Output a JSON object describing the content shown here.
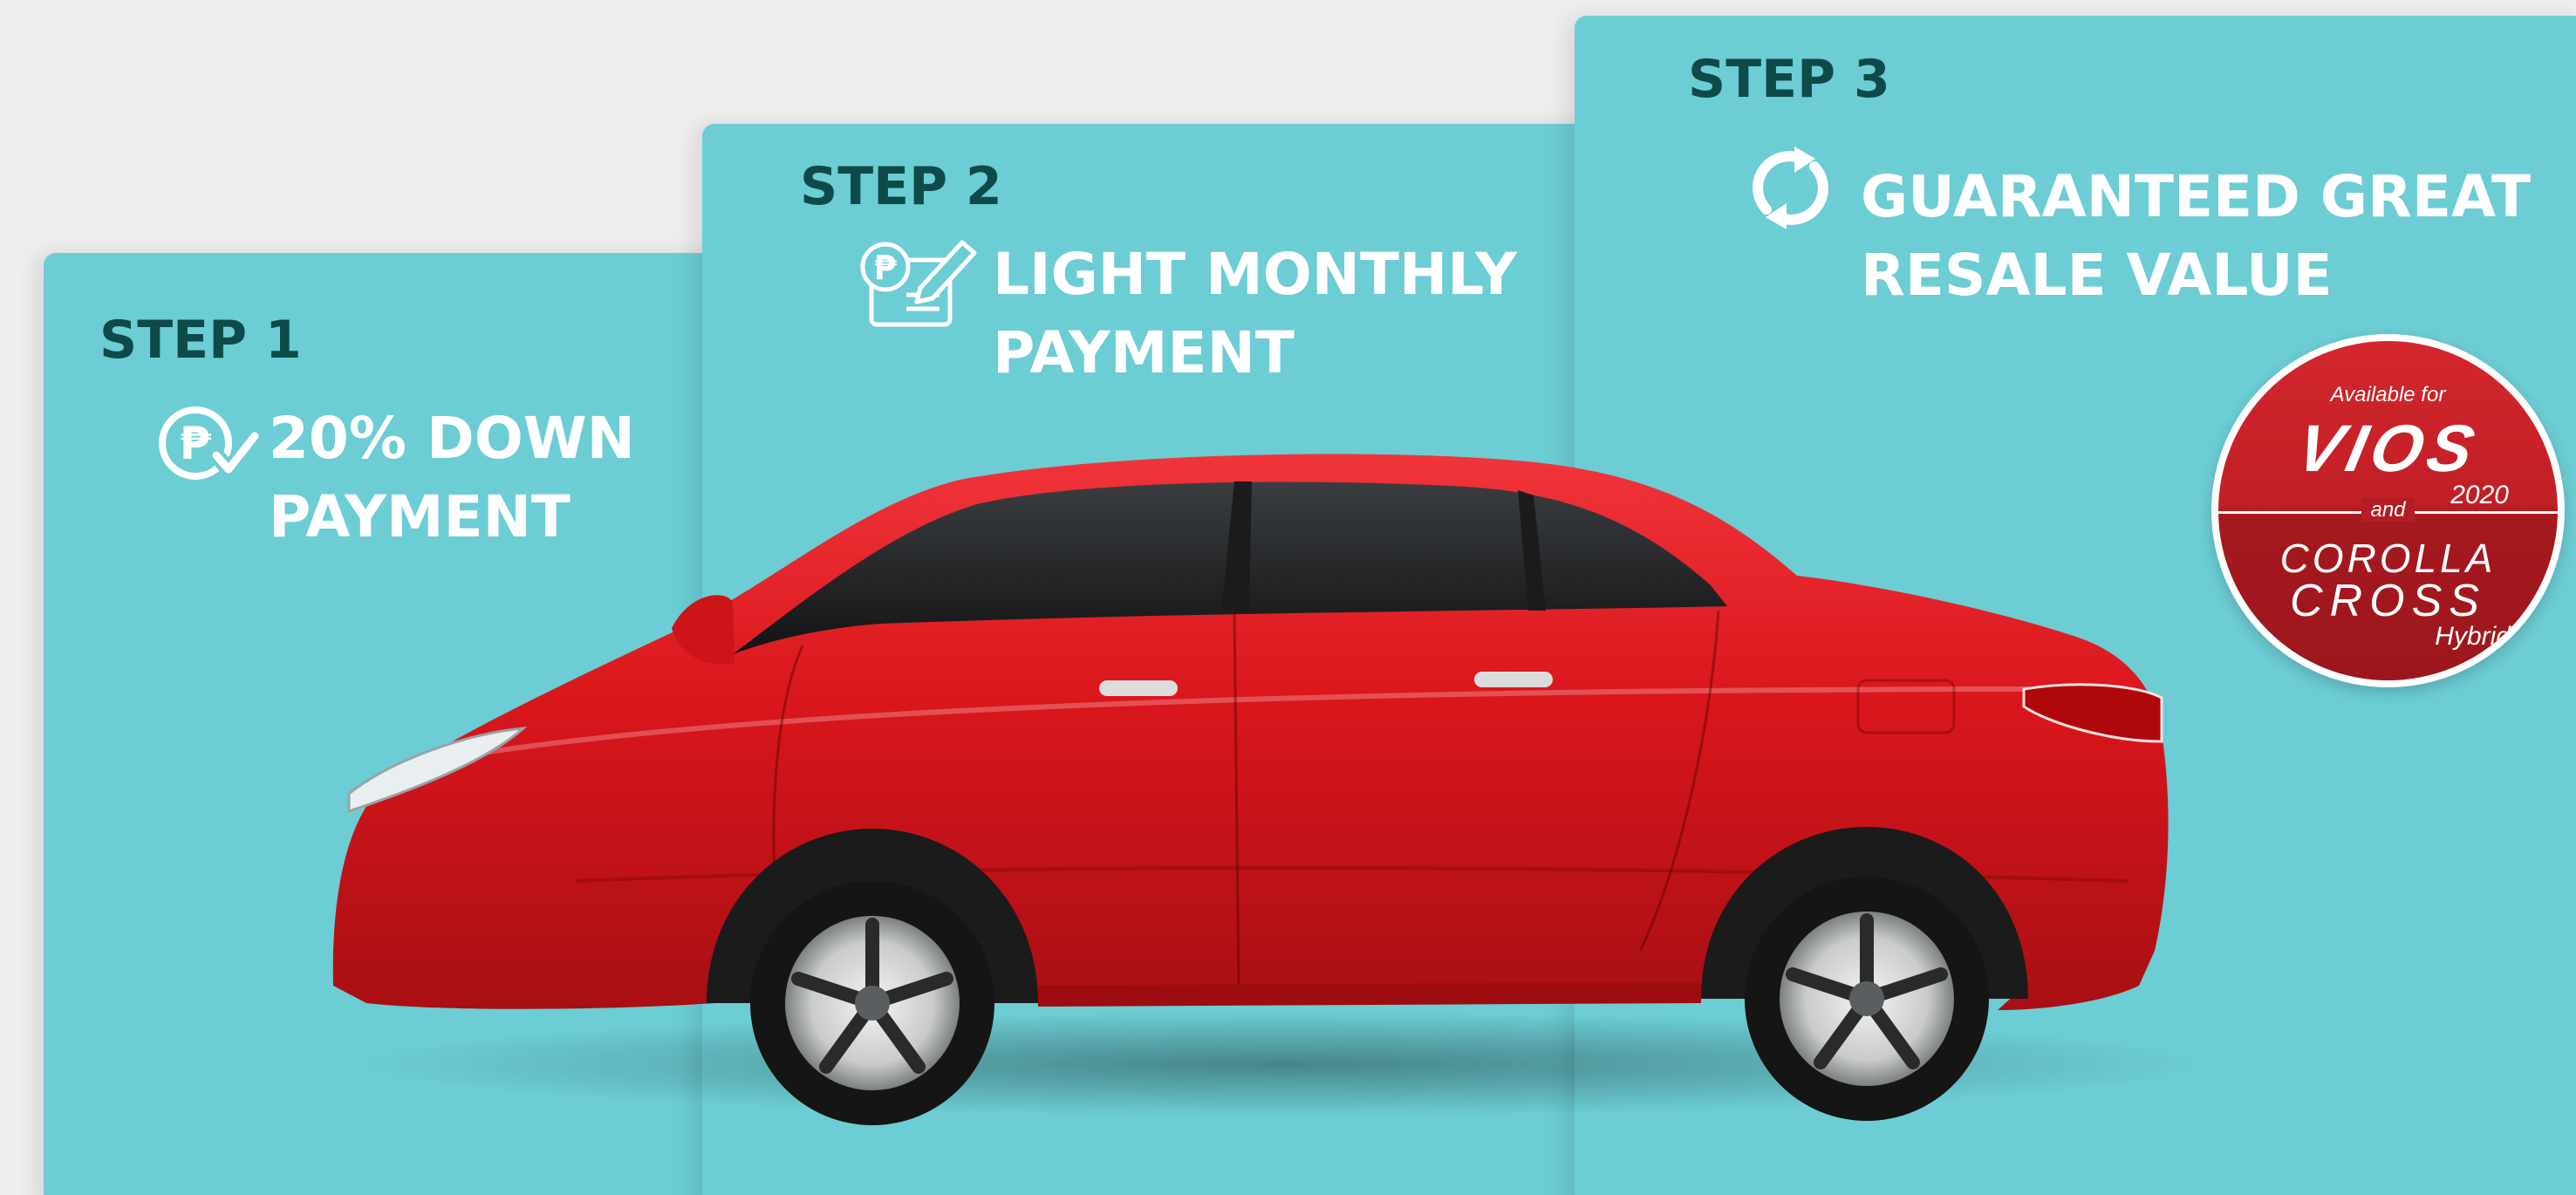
{
  "steps": [
    {
      "label": "STEP 1",
      "headline_line1": "20% DOWN",
      "headline_line2": "PAYMENT",
      "icon": "peso-check-icon"
    },
    {
      "label": "STEP 2",
      "headline_line1": "LIGHT MONTHLY",
      "headline_line2": "PAYMENT",
      "icon": "peso-document-sign-icon"
    },
    {
      "label": "STEP 3",
      "headline_line1": "GUARANTEED GREAT",
      "headline_line2": "RESALE VALUE",
      "icon": "refresh-cycle-icon"
    }
  ],
  "badge": {
    "available": "Available for",
    "model1": "VIOS",
    "model1_year": "2020",
    "and": "and",
    "model2_line1": "COROLLA",
    "model2_line2": "CROSS",
    "model2_variant": "Hybrid"
  },
  "colors": {
    "page_background": "#efefef",
    "panel": "#6ccdd4",
    "step_label": "#0f4a4b",
    "headline": "#ffffff",
    "car_body": "#d9161c",
    "badge_red": "#c01f26"
  }
}
